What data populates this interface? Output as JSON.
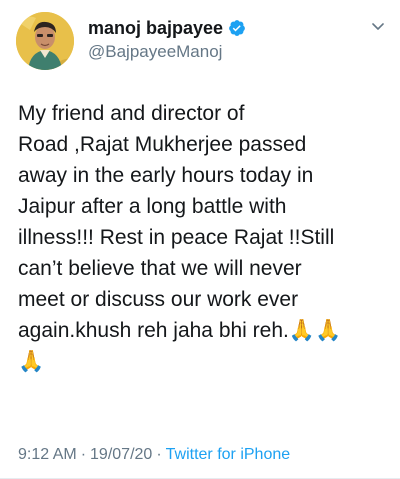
{
  "author": {
    "display_name": "manoj bajpayee",
    "handle": "@BajpayeeManoj",
    "verified": true,
    "avatar_icon": "profile-photo",
    "verified_icon": "verified-badge-icon",
    "verified_color": "#1da1f2"
  },
  "tweet": {
    "text": "My friend and director of\nRoad ,Rajat Mukherjee passed\naway in the early hours today in\nJaipur after a long battle with\nillness!!! Rest in peace Rajat !!Still\ncan’t believe that we will never\nmeet or discuss our work ever\nagain.khush reh jaha bhi reh.🙏🙏\n🙏"
  },
  "meta": {
    "time": "9:12 AM",
    "separator": "·",
    "date": "19/07/20",
    "source": "Twitter for iPhone"
  },
  "menu": {
    "icon": "chevron-down-icon"
  },
  "colors": {
    "text": "#14171a",
    "secondary": "#657786",
    "link": "#1da1f2",
    "background": "#ffffff"
  }
}
